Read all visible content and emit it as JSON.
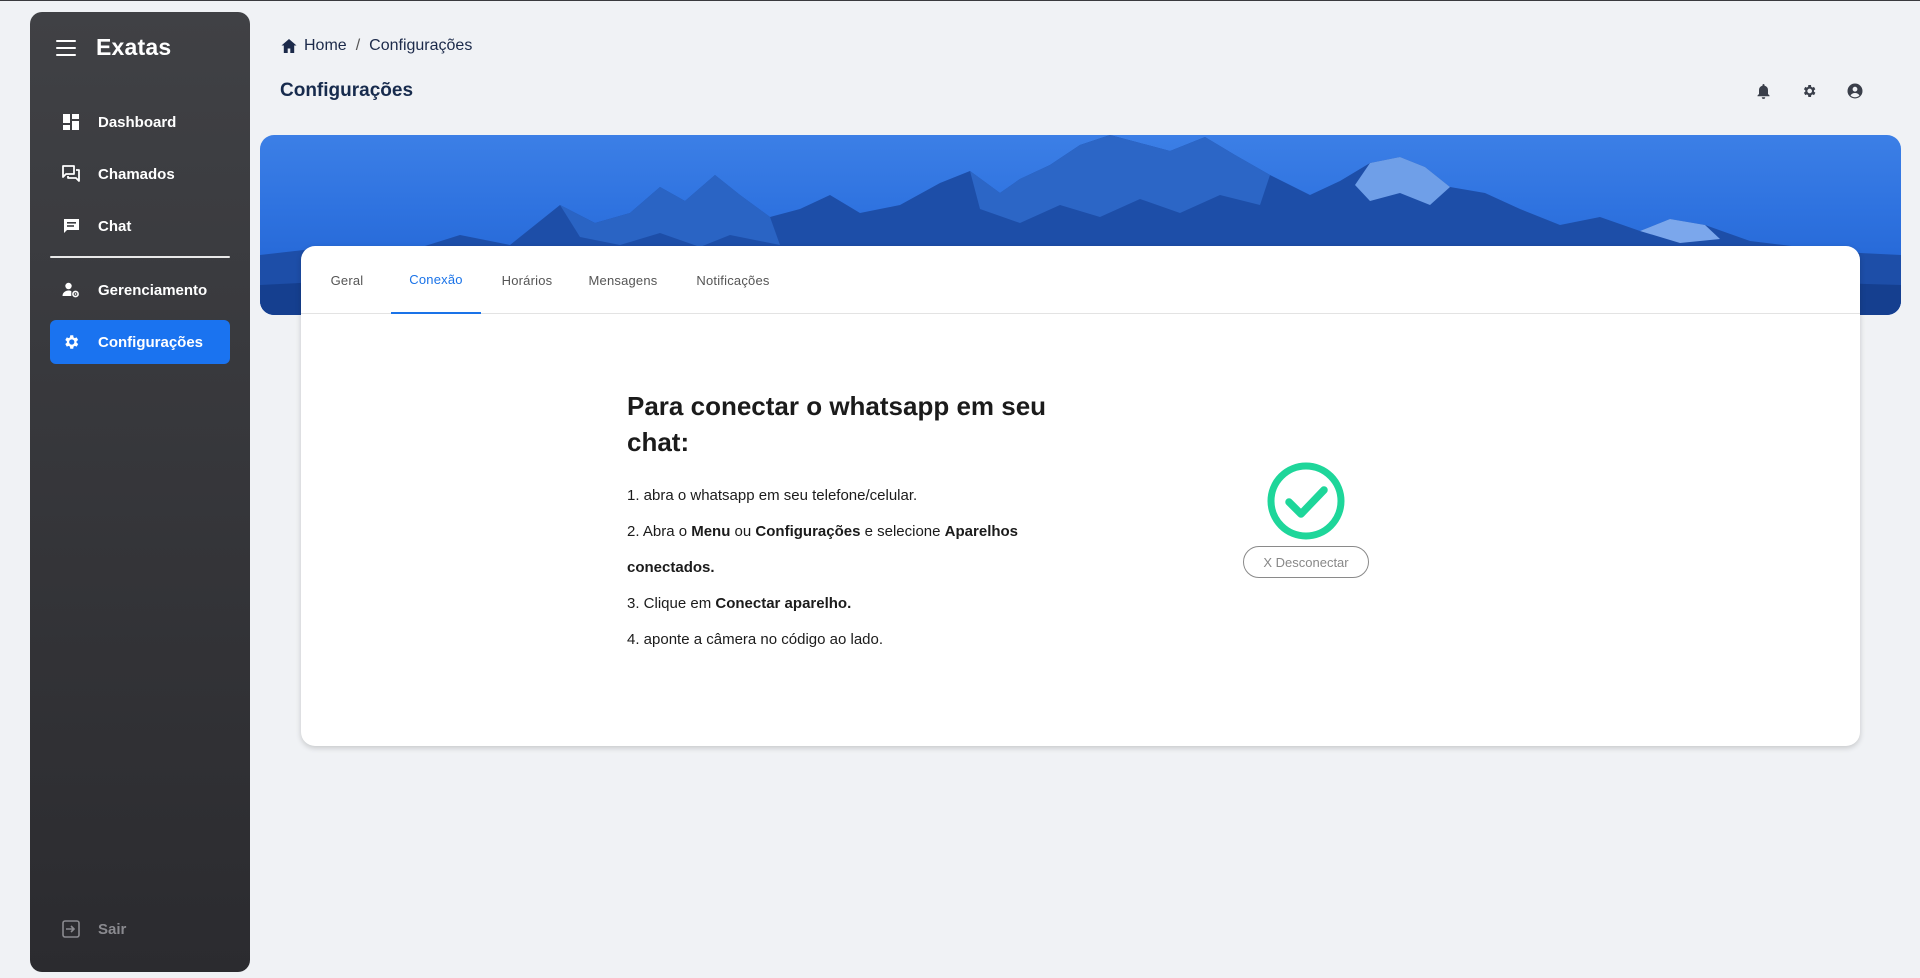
{
  "sidebar": {
    "brand": "Exatas",
    "items": [
      {
        "label": "Dashboard",
        "icon": "dashboard-icon"
      },
      {
        "label": "Chamados",
        "icon": "forum-icon"
      },
      {
        "label": "Chat",
        "icon": "chat-icon"
      },
      {
        "label": "Gerenciamento",
        "icon": "manage-accounts-icon"
      },
      {
        "label": "Configurações",
        "icon": "gear-icon",
        "active": true
      }
    ],
    "logout_label": "Sair"
  },
  "breadcrumb": {
    "home": "Home",
    "separator": "/",
    "current": "Configurações"
  },
  "page_title": "Configurações",
  "header_icons": [
    "bell-icon",
    "gear-icon",
    "account-circle-icon"
  ],
  "tabs": [
    {
      "label": "Geral"
    },
    {
      "label": "Conexão",
      "active": true
    },
    {
      "label": "Horários"
    },
    {
      "label": "Mensagens"
    },
    {
      "label": "Notificações"
    }
  ],
  "instructions": {
    "title": "Para conectar o whatsapp em seu chat:",
    "step1": "1. abra o whatsapp em seu telefone/celular.",
    "step2_a": "2. Abra o ",
    "step2_menu": "Menu",
    "step2_b": " ou ",
    "step2_config": "Configurações",
    "step2_c": " e selecione ",
    "step2_devices": "Aparelhos conectados.",
    "step3_a": "3. Clique em ",
    "step3_b": "Conectar aparelho.",
    "step4": "4. aponte a câmera no código ao lado."
  },
  "status": {
    "disconnect_label": "X Desconectar",
    "icon": "check-circle-icon"
  },
  "colors": {
    "sidebar_bg": "#3a3b3f",
    "active_nav": "#1a73f0",
    "accent": "#1a73e8",
    "success": "#1ed69a",
    "banner": "#3078e4"
  }
}
